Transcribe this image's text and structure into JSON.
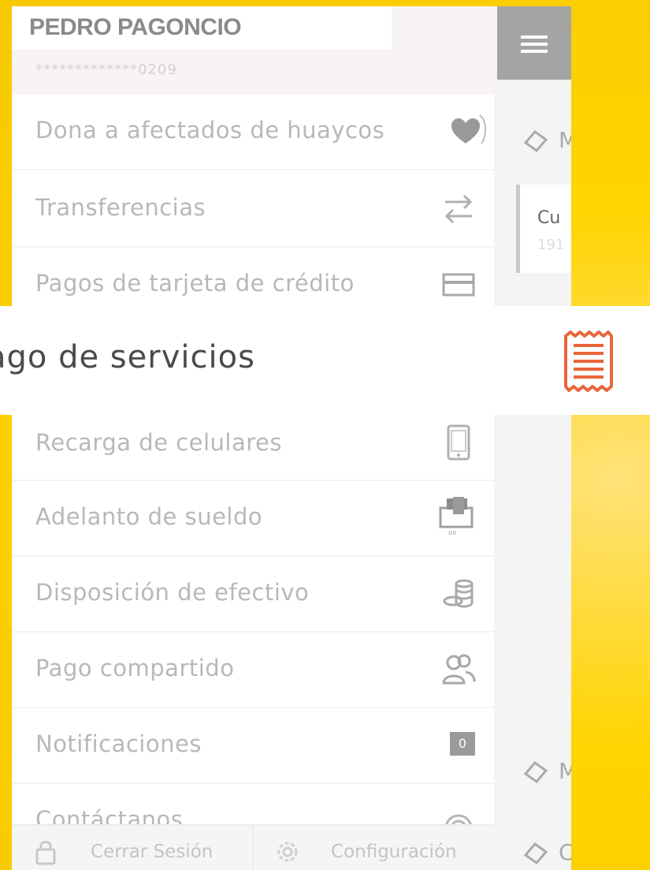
{
  "user": {
    "name": "PEDRO PAGONCIO",
    "account": "*************0209"
  },
  "menu": [
    {
      "label": "Dona a afectados de huaycos",
      "icon": "heart-icon"
    },
    {
      "label": "Transferencias",
      "icon": "transfer-arrows-icon"
    },
    {
      "label": "Pagos de tarjeta de crédito",
      "icon": "credit-card-icon"
    },
    {
      "label": "Pago de servicios",
      "icon": "receipt-icon"
    },
    {
      "label": "Recarga de celulares",
      "icon": "mobile-phone-icon"
    },
    {
      "label": "Adelanto de sueldo",
      "icon": "cash-advance-icon"
    },
    {
      "label": "Disposición de efectivo",
      "icon": "coins-stack-icon"
    },
    {
      "label": "Pago compartido",
      "icon": "shared-users-icon"
    },
    {
      "label": "Notificaciones",
      "icon": "notification-badge",
      "badge": "0"
    },
    {
      "label": "Contáctanos",
      "icon": "contact-icon"
    }
  ],
  "footer": {
    "logout_label": "Cerrar Sesión",
    "settings_label": "Configuración"
  },
  "content": {
    "card_title": "Cu",
    "card_sub": "191",
    "row_label_1": "M",
    "row_label_2": "M",
    "row_label_3": "C"
  },
  "highlight": {
    "label": "ago de servicios"
  },
  "colors": {
    "background": "#ffd400",
    "accent_icon": "#e8663a",
    "menu_text": "#b8b8b8"
  }
}
